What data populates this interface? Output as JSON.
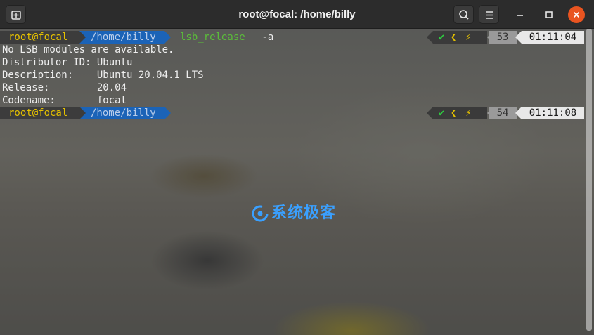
{
  "window": {
    "title": "root@focal: /home/billy",
    "new_tab_icon": "new-tab-icon",
    "search_icon": "search-icon",
    "menu_icon": "hamburger-menu-icon",
    "minimize_icon": "minimize-icon",
    "maximize_icon": "maximize-icon",
    "close_icon": "close-icon",
    "close_color": "#e95420"
  },
  "terminal": {
    "prompts": [
      {
        "user_host": "root@focal",
        "directory": "/home/billy",
        "command": "lsb_release",
        "command_args": " -a",
        "status_check": "✔",
        "status_chevron": "❮",
        "status_bolt": "⚡",
        "history_number": "53",
        "time": "01:11:04"
      },
      {
        "user_host": "root@focal",
        "directory": "/home/billy",
        "command": "",
        "command_args": "",
        "status_check": "✔",
        "status_chevron": "❮",
        "status_bolt": "⚡",
        "history_number": "54",
        "time": "01:11:08"
      }
    ],
    "output_lines": [
      "No LSB modules are available.",
      "Distributor ID: Ubuntu",
      "Description:    Ubuntu 20.04.1 LTS",
      "Release:        20.04",
      "Codename:       focal"
    ],
    "colors": {
      "user_host": "#e5c100",
      "directory_bg": "#1b63b7",
      "command": "#5bbd3a",
      "check": "#2ecc40"
    }
  },
  "watermark": {
    "text": "系统极客",
    "icon": "watermark-logo-icon"
  }
}
